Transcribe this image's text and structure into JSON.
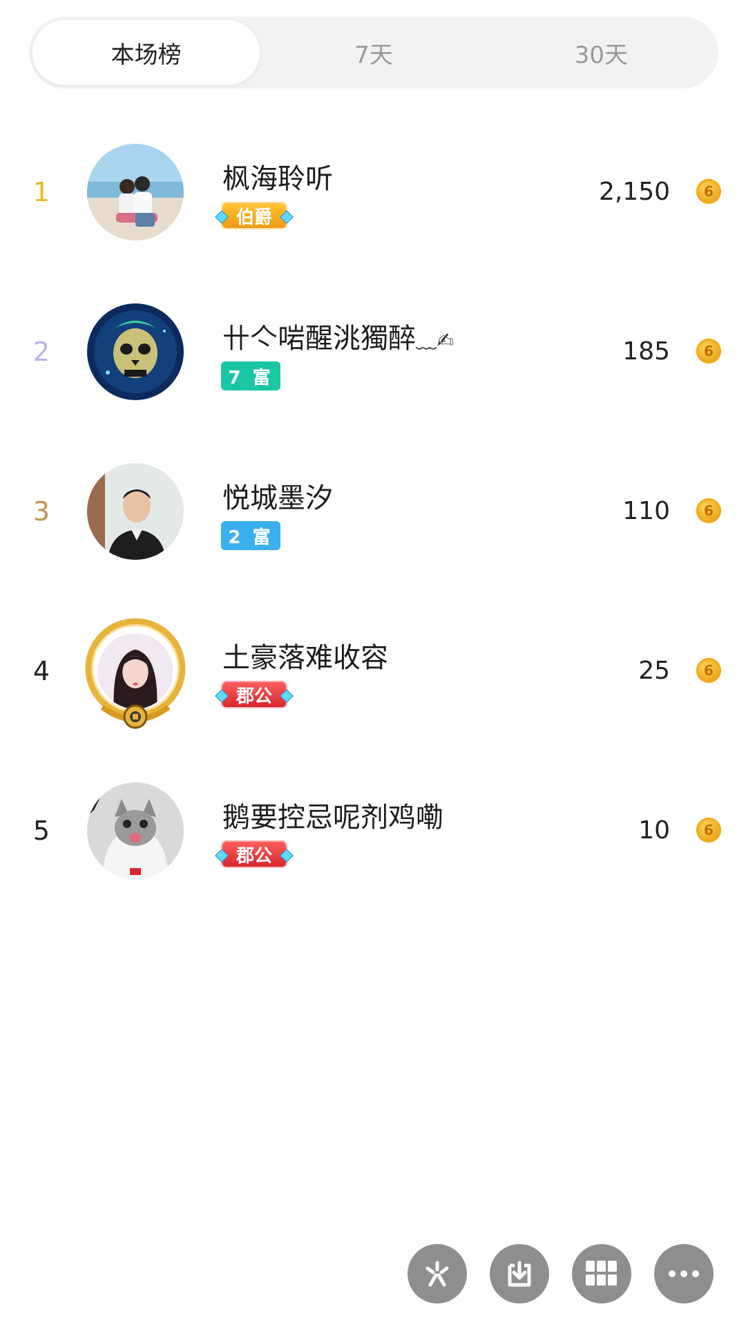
{
  "tabs": [
    {
      "label": "本场榜",
      "active": true
    },
    {
      "label": "7天",
      "active": false
    },
    {
      "label": "30天",
      "active": false
    }
  ],
  "colors": {
    "rank1": "#e9b824",
    "rank2": "#b9b3ea",
    "rank3": "#c39350",
    "rank_default": "#222222",
    "coin": "#f3a91b"
  },
  "rows": [
    {
      "rank": "1",
      "name": "枫海聆听",
      "badge": "伯爵",
      "badge_type": "noble-gold",
      "amount": "2,150",
      "avatar_icon": "couple-beach-avatar"
    },
    {
      "rank": "2",
      "name": "卄亽啱醒洮獨醉",
      "name_suffix": "﹏✍",
      "badge": "7 富",
      "badge_type": "rich7",
      "amount": "185",
      "avatar_icon": "skull-avatar"
    },
    {
      "rank": "3",
      "name": "悦城墨汐",
      "badge": "2 富",
      "badge_type": "rich2",
      "amount": "110",
      "avatar_icon": "man-portrait-avatar"
    },
    {
      "rank": "4",
      "name": "土豪落难收容",
      "badge": "郡公",
      "badge_type": "noble-red",
      "amount": "25",
      "avatar_icon": "woman-portrait-avatar"
    },
    {
      "rank": "5",
      "name": "鹅要控忌呢剂鸡嘞",
      "badge": "郡公",
      "badge_type": "noble-red",
      "amount": "10",
      "avatar_icon": "cat-avatar"
    }
  ],
  "coin_symbol": "6",
  "actions": [
    {
      "icon": "sparkle-icon"
    },
    {
      "icon": "download-icon"
    },
    {
      "icon": "grid-icon"
    },
    {
      "icon": "more-icon"
    }
  ]
}
